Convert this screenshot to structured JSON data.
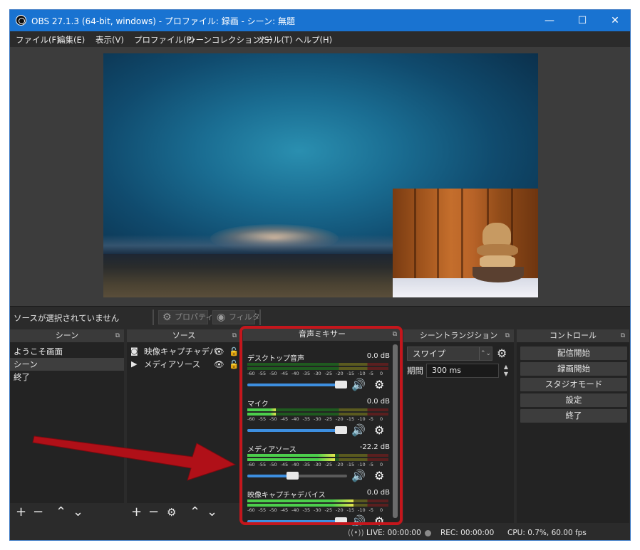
{
  "window": {
    "title": "OBS 27.1.3 (64-bit, windows) - プロファイル: 録画 - シーン: 無題",
    "controls": {
      "minimize": "—",
      "maximize": "☐",
      "close": "✕"
    }
  },
  "menu": [
    "ファイル(F)",
    "編集(E)",
    "表示(V)",
    "プロファイル(P)",
    "シーンコレクション(S)",
    "ツール(T)",
    "ヘルプ(H)"
  ],
  "source_bar": {
    "status": "ソースが選択されていません",
    "properties_label": "プロパティ",
    "filters_label": "フィルタ"
  },
  "scenes": {
    "title": "シーン",
    "items": [
      "ようこそ画面",
      "シーン",
      "終了"
    ],
    "selected": "シーン"
  },
  "sources": {
    "title": "ソース",
    "items": [
      {
        "label": "映像キャプチャデバ",
        "icon": "camera-icon"
      },
      {
        "label": "メディアソース",
        "icon": "play-icon"
      }
    ]
  },
  "mixer": {
    "title": "音声ミキサー",
    "ticks": [
      "-60",
      "-55",
      "-50",
      "-45",
      "-40",
      "-35",
      "-30",
      "-25",
      "-20",
      "-15",
      "-10",
      "-5",
      "0"
    ],
    "channels": [
      {
        "name": "デスクトップ音声",
        "db": "0.0 dB",
        "level": 0.0,
        "volume": 1.0
      },
      {
        "name": "マイク",
        "db": "0.0 dB",
        "level": 0.2,
        "volume": 1.0
      },
      {
        "name": "メディアソース",
        "db": "-22.2 dB",
        "level": 0.62,
        "volume": 0.45
      },
      {
        "name": "映像キャプチャデバイス",
        "db": "0.0 dB",
        "level": 0.75,
        "volume": 1.0
      }
    ]
  },
  "transitions": {
    "title": "シーントランジション",
    "selected": "スワイプ",
    "duration_label": "期間",
    "duration_value": "300 ms"
  },
  "controls": {
    "title": "コントロール",
    "buttons": [
      "配信開始",
      "録画開始",
      "スタジオモード",
      "設定",
      "終了"
    ]
  },
  "status": {
    "live": "LIVE: 00:00:00",
    "rec": "REC: 00:00:00",
    "cpu": "CPU: 0.7%, 60.00 fps"
  },
  "colors": {
    "accent": "#1973d1",
    "highlight": "#c4161c",
    "meter_green": "#4ccf4c"
  }
}
